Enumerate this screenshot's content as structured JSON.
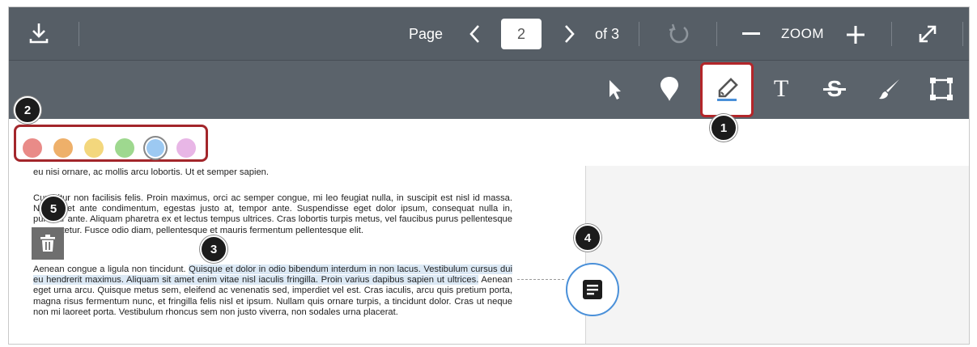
{
  "toolbar": {
    "page_label": "Page",
    "page_value": "2",
    "page_of": "of 3",
    "zoom_label": "ZOOM",
    "icons": [
      "download-icon",
      "chevron-left-icon",
      "chevron-right-icon",
      "rotate-icon",
      "zoom-out-icon",
      "zoom-in-icon",
      "fullscreen-icon"
    ]
  },
  "tools": [
    {
      "name": "pointer",
      "icon": "pointer-icon"
    },
    {
      "name": "point",
      "icon": "pin-icon"
    },
    {
      "name": "highlight",
      "icon": "highlighter-icon",
      "active": true
    },
    {
      "name": "text",
      "icon": "text-icon",
      "glyph": "T"
    },
    {
      "name": "strikeout",
      "icon": "strikethrough-icon",
      "glyph": "S"
    },
    {
      "name": "draw",
      "icon": "brush-icon"
    },
    {
      "name": "area",
      "icon": "area-icon"
    }
  ],
  "colors": [
    "#e98b88",
    "#eeb06a",
    "#f3d77d",
    "#9ed88f",
    "#9cc9f2",
    "#e8b6e6"
  ],
  "selected_color": "#9cc9f2",
  "document": {
    "para1": "eu nisi ornare, ac mollis arcu lobortis. Ut et semper sapien.",
    "para2": "Curabitur non facilisis felis. Proin maximus, orci ac semper congue, mi leo feugiat nulla, in suscipit est nisl id massa. Nam eget ante condimentum, egestas justo at, tempor ante. Suspendisse eget dolor ipsum, consequat nulla in, pulvinar ante. Aliquam pharetra ex et lectus tempus ultrices. Cras lobortis turpis metus, vel faucibus purus pellentesque consectetur. Fusce odio diam, pellentesque et mauris fermentum pellentesque elit.",
    "para3_pre": "Aenean congue a ligula non tincidunt. ",
    "para3_hl": "Quisque et dolor in odio bibendum interdum in non lacus. Vestibulum cursus dui eu hendrerit maximus. Aliquam sit amet enim vitae nisl iaculis fringilla. Proin varius dapibus sapien ut ultrices.",
    "para3_post": " Aenean eget urna arcu. Quisque metus sem, eleifend ac venenatis sed, imperdiet vel est. Cras iaculis, arcu quis pretium porta, magna risus fermentum nunc, et fringilla felis nisl et ipsum. Nullam quis ornare turpis, a tincidunt dolor. Cras ut neque non mi laoreet porta. Vestibulum rhoncus sem non justo viverra, non sodales urna placerat."
  },
  "callouts": [
    "1",
    "2",
    "3",
    "4",
    "5"
  ],
  "annotation_icons": [
    "trash-icon",
    "comment-icon"
  ],
  "accent": "#a3262b"
}
